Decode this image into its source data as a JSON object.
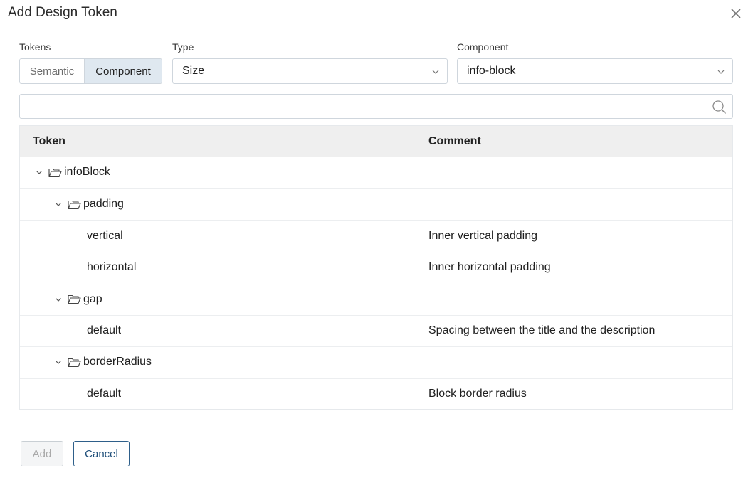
{
  "dialog": {
    "title": "Add Design Token",
    "close_icon": "close-icon"
  },
  "filters": {
    "tokens_label": "Tokens",
    "tokens_options": [
      "Semantic",
      "Component"
    ],
    "tokens_selected": "Component",
    "type_label": "Type",
    "type_value": "Size",
    "component_label": "Component",
    "component_value": "info-block"
  },
  "search": {
    "placeholder": "",
    "value": "",
    "icon": "search-icon"
  },
  "table": {
    "columns": [
      "Token",
      "Comment"
    ],
    "rows": [
      {
        "level": 0,
        "kind": "group",
        "name": "infoBlock",
        "comment": ""
      },
      {
        "level": 1,
        "kind": "group",
        "name": "padding",
        "comment": ""
      },
      {
        "level": 2,
        "kind": "token",
        "name": "vertical",
        "comment": "Inner vertical padding"
      },
      {
        "level": 2,
        "kind": "token",
        "name": "horizontal",
        "comment": "Inner horizontal padding"
      },
      {
        "level": 1,
        "kind": "group",
        "name": "gap",
        "comment": ""
      },
      {
        "level": 2,
        "kind": "token",
        "name": "default",
        "comment": "Spacing between the title and the description"
      },
      {
        "level": 1,
        "kind": "group",
        "name": "borderRadius",
        "comment": ""
      },
      {
        "level": 2,
        "kind": "token",
        "name": "default",
        "comment": "Block border radius"
      }
    ]
  },
  "footer": {
    "add_label": "Add",
    "add_disabled": true,
    "cancel_label": "Cancel"
  },
  "colors": {
    "accent": "#2e5f8a",
    "selected_segment": "#dfe8f0",
    "header_bg": "#efefef"
  }
}
